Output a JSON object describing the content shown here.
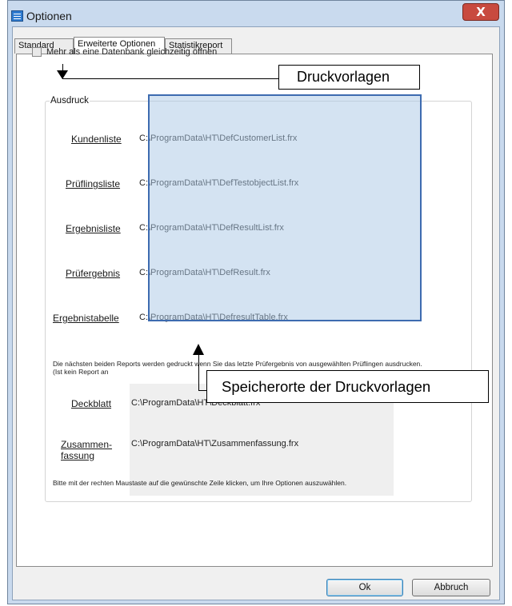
{
  "window": {
    "title": "Optionen",
    "close_label": "X"
  },
  "tabs": [
    {
      "label": "Standard",
      "active": false
    },
    {
      "label": "Erweiterte Optionen",
      "active": true
    },
    {
      "label": "Statistikreport",
      "active": false
    }
  ],
  "checkbox": {
    "label": "Mehr als eine Datenbank gleichzeitig öffnen",
    "checked": false
  },
  "group": {
    "title": "Ausdruck"
  },
  "reports": [
    {
      "label": "Kundenliste",
      "path": "C:\\ProgramData\\HT\\DefCustomerList.frx"
    },
    {
      "label": "Prüflingsliste",
      "path": "C:\\ProgramData\\HT\\DefTestobjectList.frx"
    },
    {
      "label": "Ergebnisliste",
      "path": "C:\\ProgramData\\HT\\DefResultList.frx"
    },
    {
      "label": "Prüfergebnis",
      "path": "C:\\ProgramData\\HT\\DefResult.frx"
    },
    {
      "label": "Ergebnistabelle",
      "path": "C:\\ProgramData\\HT\\DefresultTable.frx"
    }
  ],
  "note": "Die nächsten beiden Reports werden gedruckt wenn Sie das letzte Prüfergebnis von ausgewählten Prüflingen ausdrucken. (Ist kein Report an",
  "special_reports": [
    {
      "label": "Deckblatt",
      "path": "C:\\ProgramData\\HT\\Deckblatt.frx"
    },
    {
      "label_line1": "Zusammen-",
      "label_line2": "fassung",
      "path": "C:\\ProgramData\\HT\\Zusammenfassung.frx"
    }
  ],
  "hint": "Bitte mit der rechten Maustaste auf die gewünschte Zeile klicken, um Ihre Optionen auszuwählen.",
  "annotations": {
    "druckvorlagen": "Druckvorlagen",
    "speicherorte": "Speicherorte der Druckvorlagen"
  },
  "buttons": {
    "ok": "Ok",
    "cancel": "Abbruch"
  }
}
